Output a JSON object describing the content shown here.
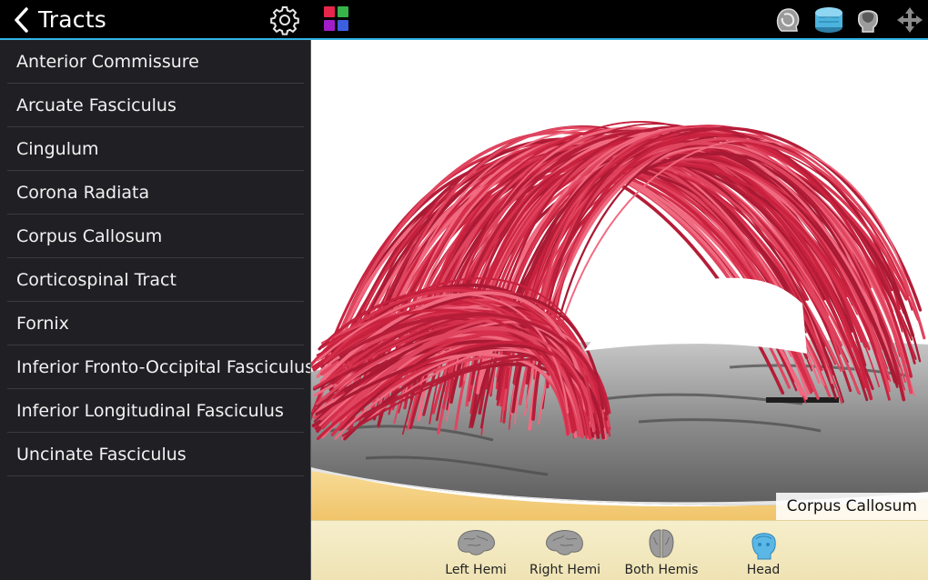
{
  "header": {
    "title": "Tracts",
    "back_icon": "chevron-left-icon",
    "settings_icon": "gear-icon",
    "color_picker_icon": "color-grid-icon",
    "color_grid": [
      "#e8254a",
      "#37b34a",
      "#a01dc9",
      "#3b5fe0"
    ],
    "accent_color": "#33b5e5",
    "view_tools": [
      "head-side-icon",
      "brain-slab-icon",
      "skull-front-icon",
      "move-arrows-icon"
    ]
  },
  "sidebar": {
    "items": [
      {
        "label": "Anterior Commissure"
      },
      {
        "label": "Arcuate Fasciculus"
      },
      {
        "label": "Cingulum"
      },
      {
        "label": "Corona Radiata"
      },
      {
        "label": "Corpus Callosum"
      },
      {
        "label": "Corticospinal Tract"
      },
      {
        "label": "Fornix"
      },
      {
        "label": "Inferior Fronto-Occipital Fasciculus"
      },
      {
        "label": "Inferior Longitudinal Fasciculus"
      },
      {
        "label": "Uncinate Fasciculus"
      }
    ]
  },
  "viewport": {
    "caption": "Corpus Callosum",
    "tract_color": "#c8223f",
    "slice_color": "#8a8a8a",
    "base_color": "#f3cc7a"
  },
  "bottom_bar": {
    "buttons": [
      {
        "label": "Left Hemi",
        "icon": "left-hemisphere-icon"
      },
      {
        "label": "Right Hemi",
        "icon": "right-hemisphere-icon"
      },
      {
        "label": "Both Hemis",
        "icon": "both-hemispheres-icon"
      },
      {
        "label": "Head",
        "icon": "head-icon"
      }
    ]
  }
}
